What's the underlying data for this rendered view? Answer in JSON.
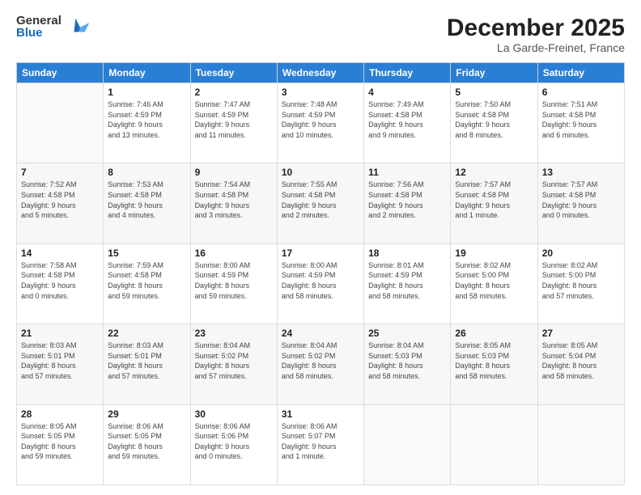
{
  "logo": {
    "general": "General",
    "blue": "Blue"
  },
  "title": "December 2025",
  "subtitle": "La Garde-Freinet, France",
  "days_header": [
    "Sunday",
    "Monday",
    "Tuesday",
    "Wednesday",
    "Thursday",
    "Friday",
    "Saturday"
  ],
  "weeks": [
    [
      {
        "day": "",
        "info": ""
      },
      {
        "day": "1",
        "info": "Sunrise: 7:46 AM\nSunset: 4:59 PM\nDaylight: 9 hours\nand 13 minutes."
      },
      {
        "day": "2",
        "info": "Sunrise: 7:47 AM\nSunset: 4:59 PM\nDaylight: 9 hours\nand 11 minutes."
      },
      {
        "day": "3",
        "info": "Sunrise: 7:48 AM\nSunset: 4:59 PM\nDaylight: 9 hours\nand 10 minutes."
      },
      {
        "day": "4",
        "info": "Sunrise: 7:49 AM\nSunset: 4:58 PM\nDaylight: 9 hours\nand 9 minutes."
      },
      {
        "day": "5",
        "info": "Sunrise: 7:50 AM\nSunset: 4:58 PM\nDaylight: 9 hours\nand 8 minutes."
      },
      {
        "day": "6",
        "info": "Sunrise: 7:51 AM\nSunset: 4:58 PM\nDaylight: 9 hours\nand 6 minutes."
      }
    ],
    [
      {
        "day": "7",
        "info": "Sunrise: 7:52 AM\nSunset: 4:58 PM\nDaylight: 9 hours\nand 5 minutes."
      },
      {
        "day": "8",
        "info": "Sunrise: 7:53 AM\nSunset: 4:58 PM\nDaylight: 9 hours\nand 4 minutes."
      },
      {
        "day": "9",
        "info": "Sunrise: 7:54 AM\nSunset: 4:58 PM\nDaylight: 9 hours\nand 3 minutes."
      },
      {
        "day": "10",
        "info": "Sunrise: 7:55 AM\nSunset: 4:58 PM\nDaylight: 9 hours\nand 2 minutes."
      },
      {
        "day": "11",
        "info": "Sunrise: 7:56 AM\nSunset: 4:58 PM\nDaylight: 9 hours\nand 2 minutes."
      },
      {
        "day": "12",
        "info": "Sunrise: 7:57 AM\nSunset: 4:58 PM\nDaylight: 9 hours\nand 1 minute."
      },
      {
        "day": "13",
        "info": "Sunrise: 7:57 AM\nSunset: 4:58 PM\nDaylight: 9 hours\nand 0 minutes."
      }
    ],
    [
      {
        "day": "14",
        "info": "Sunrise: 7:58 AM\nSunset: 4:58 PM\nDaylight: 9 hours\nand 0 minutes."
      },
      {
        "day": "15",
        "info": "Sunrise: 7:59 AM\nSunset: 4:58 PM\nDaylight: 8 hours\nand 59 minutes."
      },
      {
        "day": "16",
        "info": "Sunrise: 8:00 AM\nSunset: 4:59 PM\nDaylight: 8 hours\nand 59 minutes."
      },
      {
        "day": "17",
        "info": "Sunrise: 8:00 AM\nSunset: 4:59 PM\nDaylight: 8 hours\nand 58 minutes."
      },
      {
        "day": "18",
        "info": "Sunrise: 8:01 AM\nSunset: 4:59 PM\nDaylight: 8 hours\nand 58 minutes."
      },
      {
        "day": "19",
        "info": "Sunrise: 8:02 AM\nSunset: 5:00 PM\nDaylight: 8 hours\nand 58 minutes."
      },
      {
        "day": "20",
        "info": "Sunrise: 8:02 AM\nSunset: 5:00 PM\nDaylight: 8 hours\nand 57 minutes."
      }
    ],
    [
      {
        "day": "21",
        "info": "Sunrise: 8:03 AM\nSunset: 5:01 PM\nDaylight: 8 hours\nand 57 minutes."
      },
      {
        "day": "22",
        "info": "Sunrise: 8:03 AM\nSunset: 5:01 PM\nDaylight: 8 hours\nand 57 minutes."
      },
      {
        "day": "23",
        "info": "Sunrise: 8:04 AM\nSunset: 5:02 PM\nDaylight: 8 hours\nand 57 minutes."
      },
      {
        "day": "24",
        "info": "Sunrise: 8:04 AM\nSunset: 5:02 PM\nDaylight: 8 hours\nand 58 minutes."
      },
      {
        "day": "25",
        "info": "Sunrise: 8:04 AM\nSunset: 5:03 PM\nDaylight: 8 hours\nand 58 minutes."
      },
      {
        "day": "26",
        "info": "Sunrise: 8:05 AM\nSunset: 5:03 PM\nDaylight: 8 hours\nand 58 minutes."
      },
      {
        "day": "27",
        "info": "Sunrise: 8:05 AM\nSunset: 5:04 PM\nDaylight: 8 hours\nand 58 minutes."
      }
    ],
    [
      {
        "day": "28",
        "info": "Sunrise: 8:05 AM\nSunset: 5:05 PM\nDaylight: 8 hours\nand 59 minutes."
      },
      {
        "day": "29",
        "info": "Sunrise: 8:06 AM\nSunset: 5:05 PM\nDaylight: 8 hours\nand 59 minutes."
      },
      {
        "day": "30",
        "info": "Sunrise: 8:06 AM\nSunset: 5:06 PM\nDaylight: 9 hours\nand 0 minutes."
      },
      {
        "day": "31",
        "info": "Sunrise: 8:06 AM\nSunset: 5:07 PM\nDaylight: 9 hours\nand 1 minute."
      },
      {
        "day": "",
        "info": ""
      },
      {
        "day": "",
        "info": ""
      },
      {
        "day": "",
        "info": ""
      }
    ]
  ]
}
